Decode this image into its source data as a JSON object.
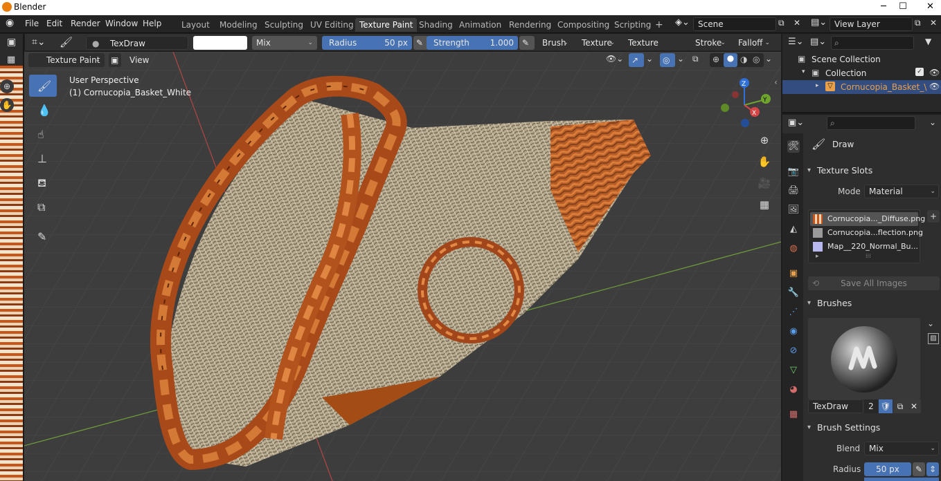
{
  "window": {
    "title": "Blender",
    "minimize": "─",
    "maximize": "☐",
    "close": "✕"
  },
  "menu": {
    "items": [
      "File",
      "Edit",
      "Render",
      "Window",
      "Help"
    ]
  },
  "workspaces": {
    "tabs": [
      "Layout",
      "Modeling",
      "Sculpting",
      "UV Editing",
      "Texture Paint",
      "Shading",
      "Animation",
      "Rendering",
      "Compositing",
      "Scripting"
    ],
    "active": "Texture Paint",
    "add": "+"
  },
  "scene": {
    "name": "Scene",
    "view_layer": "View Layer"
  },
  "tool_header": {
    "brush_name": "TexDraw",
    "blend": "Mix",
    "radius_label": "Radius",
    "radius_value": "50 px",
    "strength_label": "Strength",
    "strength_value": "1.000",
    "strength_fill": 1.0,
    "menus": [
      "Brush",
      "Texture",
      "Texture Mask",
      "Stroke",
      "Falloff"
    ]
  },
  "viewport": {
    "mode": "Texture Paint",
    "view_menu": "View",
    "perspective": "User Perspective",
    "object_label": "(1) Cornucopia_Basket_White",
    "gizmo": {
      "x": "X",
      "y": "Y",
      "z": "Z"
    }
  },
  "outliner": {
    "scene_collection": "Scene Collection",
    "collection": "Collection",
    "object": "Cornucopia_Basket_\\"
  },
  "properties": {
    "tool_name": "Draw",
    "texture_slots": {
      "title": "Texture Slots",
      "mode_label": "Mode",
      "mode_value": "Material",
      "slots": [
        "Cornucopia..._Diffuse.png",
        "Cornucopia...flection.png",
        "Map__220_Normal_Bu..."
      ],
      "save_all": "Save All Images"
    },
    "brushes": {
      "title": "Brushes",
      "brush_name": "TexDraw",
      "users": "2"
    },
    "brush_settings": {
      "title": "Brush Settings",
      "blend_label": "Blend",
      "blend_value": "Mix",
      "radius_label": "Radius",
      "radius_value": "50 px"
    }
  },
  "colors": {
    "accent": "#4772b3",
    "active_object": "#e8a04a",
    "paint_color": "#ffffff"
  }
}
